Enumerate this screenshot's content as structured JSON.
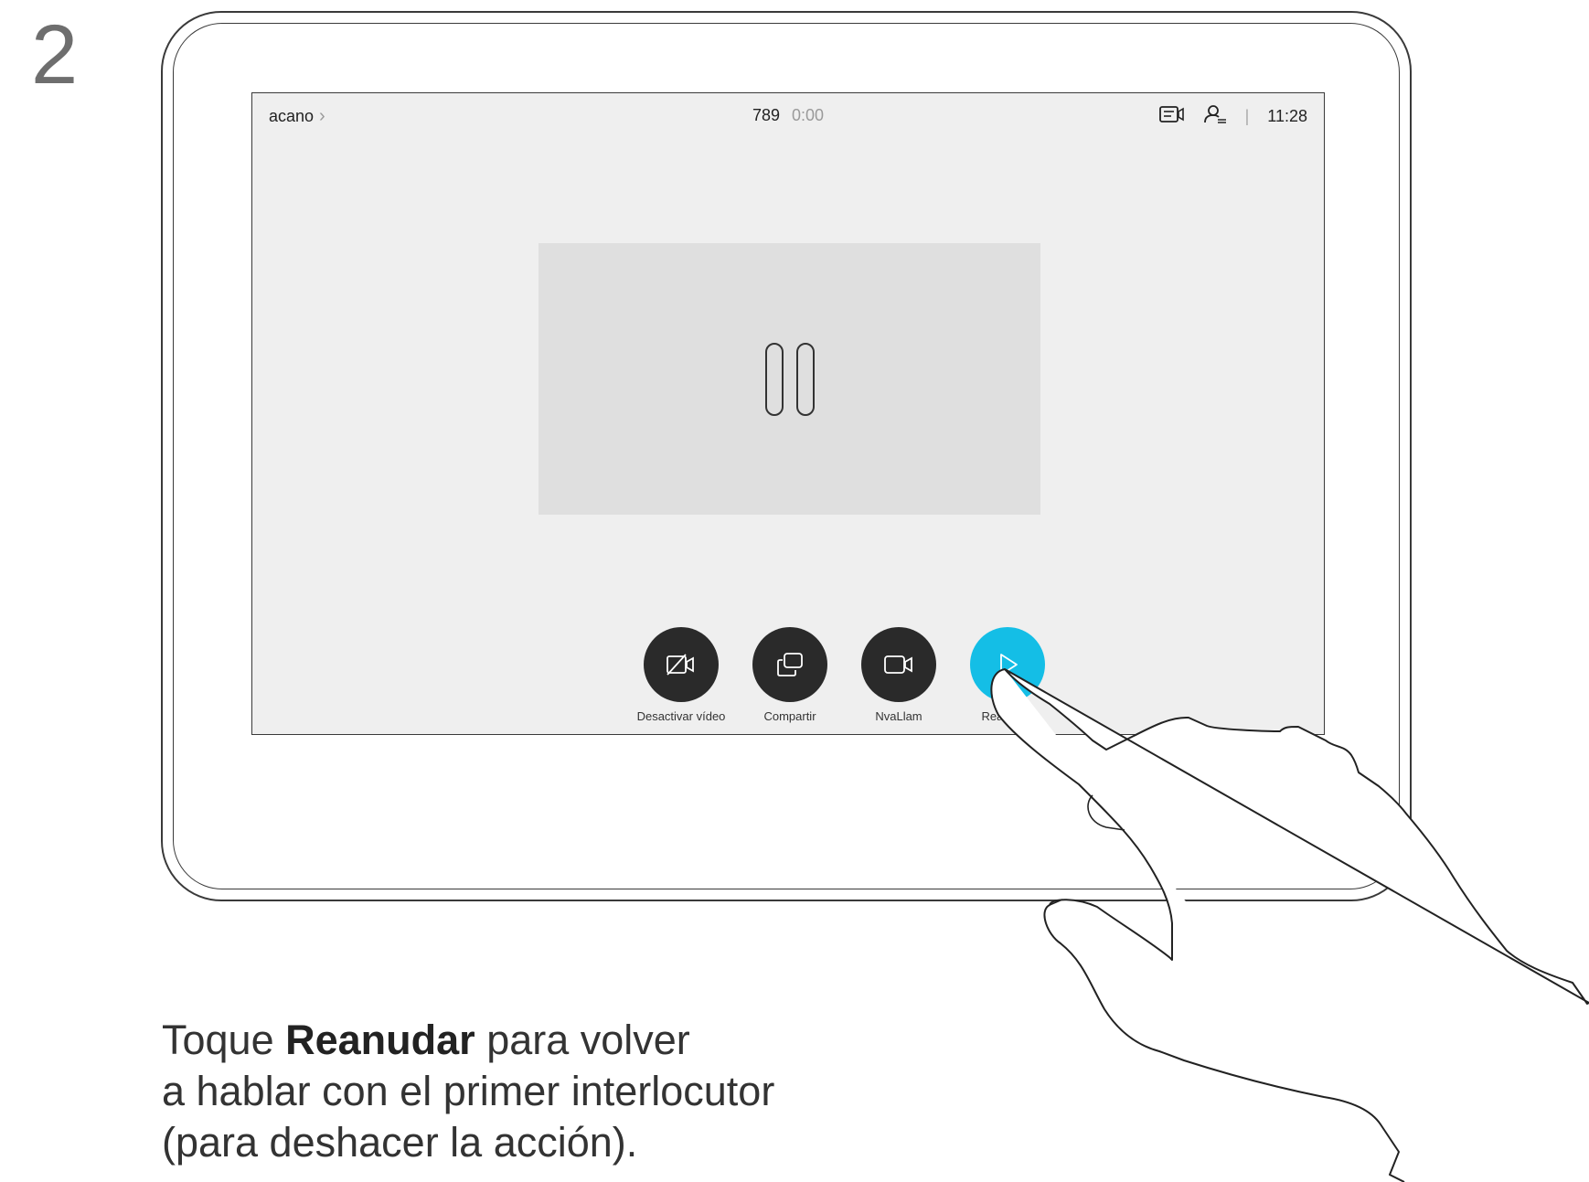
{
  "step": "2",
  "screen": {
    "contact": "acano",
    "call_number": "789",
    "call_timer": "0:00",
    "clock": "11:28",
    "separator": "|"
  },
  "controls": [
    {
      "label": "Desactivar vídeo",
      "icon": "video-off-icon"
    },
    {
      "label": "Compartir",
      "icon": "share-icon"
    },
    {
      "label": "NvaLlam",
      "icon": "video-camera-icon"
    },
    {
      "label": "Reanudar",
      "icon": "play-icon",
      "active": true
    }
  ],
  "caption": {
    "before": "Toque ",
    "bold": "Reanudar",
    "after": " para volver",
    "line2": "a hablar con el primer interlocutor",
    "line3": "(para deshacer la acción)."
  },
  "colors": {
    "accent": "#14bee6",
    "button_dark": "#2a2a2a",
    "screen_bg": "#efefef",
    "video_bg": "#dfdfdf"
  }
}
